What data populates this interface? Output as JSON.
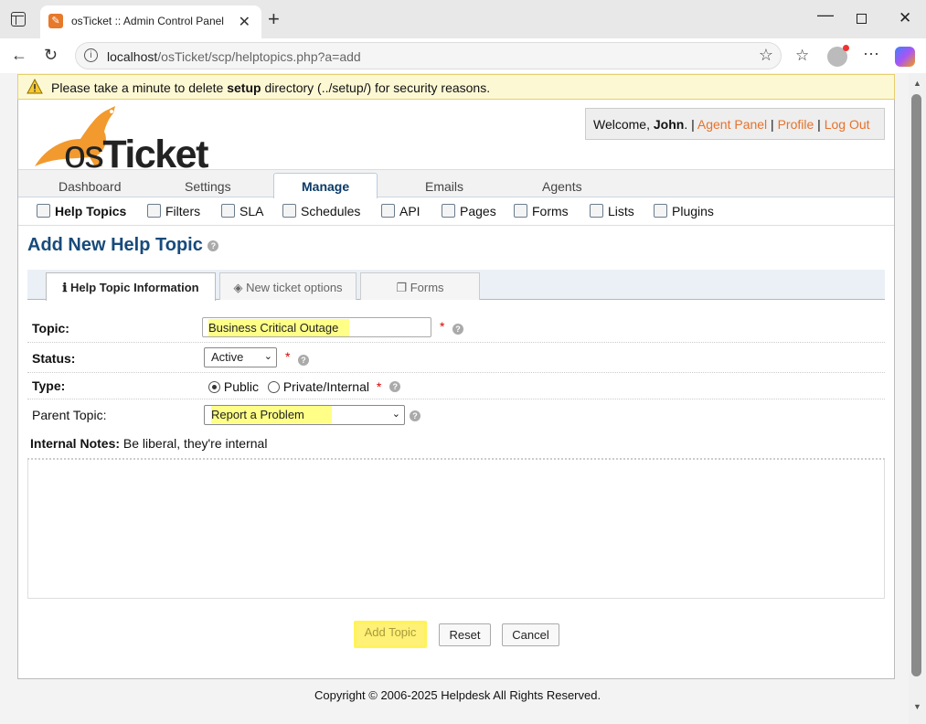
{
  "browser": {
    "tab_title": "osTicket :: Admin Control Panel",
    "url_host": "localhost",
    "url_path": "/osTicket/scp/helptopics.php?a=add"
  },
  "notice": {
    "prefix": "Please take a minute to delete ",
    "bold": "setup",
    "suffix": " directory (../setup/) for security reasons."
  },
  "header": {
    "logo_os": "os",
    "logo_ticket": "Ticket",
    "welcome_prefix": "Welcome, ",
    "user": "John",
    "welcome_suffix": ". |",
    "agent_panel": "Agent Panel",
    "profile": "Profile",
    "logout": "Log Out"
  },
  "nav": {
    "tabs": [
      "Dashboard",
      "Settings",
      "Manage",
      "Emails",
      "Agents"
    ],
    "active": "Manage"
  },
  "subnav": {
    "items": [
      "Help Topics",
      "Filters",
      "SLA",
      "Schedules",
      "API",
      "Pages",
      "Forms",
      "Lists",
      "Plugins"
    ]
  },
  "page": {
    "title": "Add New Help Topic"
  },
  "form_tabs": [
    "Help Topic Information",
    "New ticket options",
    "Forms"
  ],
  "form": {
    "topic_label": "Topic:",
    "topic_value": "Business Critical Outage",
    "status_label": "Status:",
    "status_value": "Active",
    "type_label": "Type:",
    "type_public": "Public",
    "type_private": "Private/Internal",
    "parent_label": "Parent Topic:",
    "parent_value": "Report a Problem",
    "notes_label": "Internal Notes:",
    "notes_hint": " Be liberal, they're internal",
    "required_mark": "*"
  },
  "buttons": {
    "add": "Add Topic",
    "reset": "Reset",
    "cancel": "Cancel"
  },
  "footer": {
    "copyright": "Copyright © 2006-2025 Helpdesk All Rights Reserved."
  },
  "colors": {
    "accent": "#e6722b",
    "title": "#174a7b",
    "highlight": "#ffff88"
  }
}
